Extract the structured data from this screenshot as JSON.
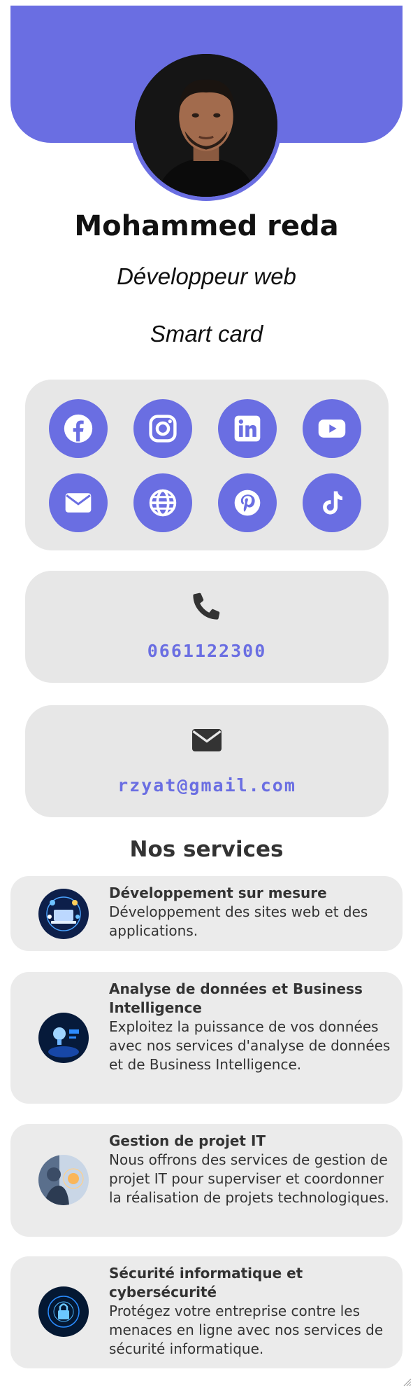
{
  "profile": {
    "name": "Mohammed reda",
    "title": "Développeur web",
    "card_label": "Smart card"
  },
  "colors": {
    "accent": "#6a6ee2",
    "panel": "#e7e7e7",
    "service_panel": "#ebebeb",
    "contact_icon": "#333333"
  },
  "social": [
    {
      "icon": "facebook-icon",
      "name": "Facebook"
    },
    {
      "icon": "instagram-icon",
      "name": "Instagram"
    },
    {
      "icon": "linkedin-icon",
      "name": "LinkedIn"
    },
    {
      "icon": "youtube-icon",
      "name": "YouTube"
    },
    {
      "icon": "envelope-icon",
      "name": "Email"
    },
    {
      "icon": "globe-icon",
      "name": "Website"
    },
    {
      "icon": "pinterest-icon",
      "name": "Pinterest"
    },
    {
      "icon": "tiktok-icon",
      "name": "TikTok"
    }
  ],
  "contact": {
    "phone": {
      "icon": "phone-icon",
      "value": "0661122300"
    },
    "email": {
      "icon": "envelope-icon",
      "value": "rzyat@gmail.com"
    }
  },
  "services": {
    "heading": "Nos services",
    "items": [
      {
        "title": "Développement sur mesure",
        "description": "Développement des sites web et des applications."
      },
      {
        "title": "Analyse de données et Business Intelligence",
        "description": "Exploitez la puissance de vos données avec nos services d'analyse de données et de Business Intelligence."
      },
      {
        "title": "Gestion de projet IT",
        "description": "Nous offrons des services de gestion de projet IT pour superviser et coordonner la réalisation de projets technologiques."
      },
      {
        "title": "Sécurité informatique et cybersécurité",
        "description": "Protégez votre entreprise contre les menaces en ligne avec nos services de sécurité informatique."
      }
    ]
  }
}
